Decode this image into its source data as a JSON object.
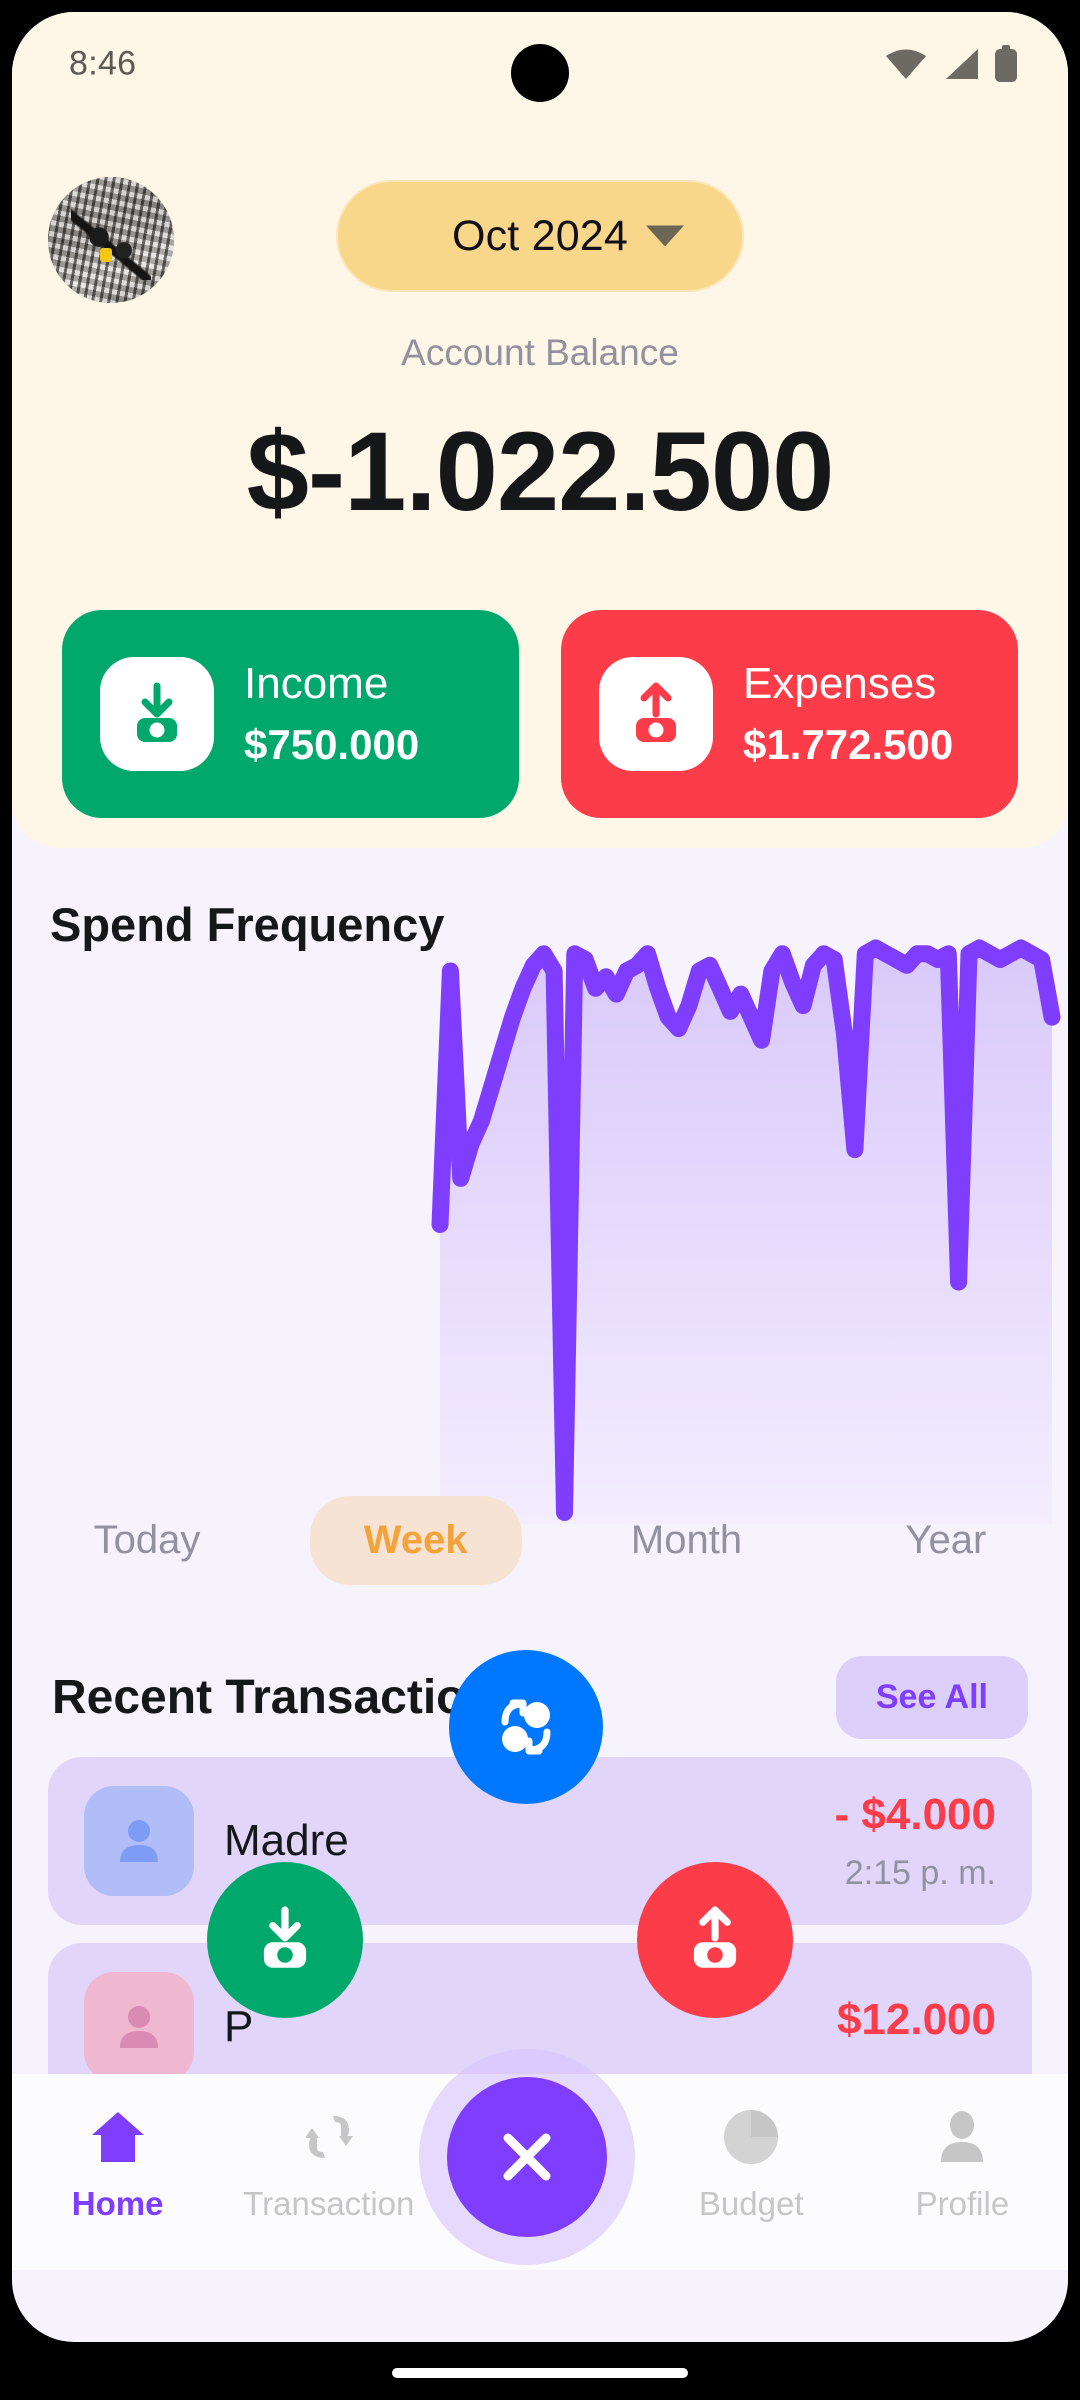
{
  "status_bar": {
    "time": "8:46",
    "icons": [
      "wifi-icon",
      "cellular-icon",
      "battery-icon"
    ]
  },
  "header": {
    "avatar": "user-avatar-motorcycle-photo",
    "month_selector": {
      "value": "Oct 2024",
      "caret": "chevron-down-icon"
    },
    "balance_label": "Account Balance",
    "balance_amount": "$-1.022.500"
  },
  "summary_cards": [
    {
      "type": "income",
      "title": "Income",
      "amount": "$750.000",
      "color": "#00A86B",
      "icon": "income-arrow-down-icon"
    },
    {
      "type": "expense",
      "title": "Expenses",
      "amount": "$1.772.500",
      "color": "#FD3C4A",
      "icon": "expense-arrow-up-icon"
    }
  ],
  "spend_frequency": {
    "title": "Spend Frequency",
    "tabs": [
      {
        "label": "Today",
        "active": false
      },
      {
        "label": "Week",
        "active": true
      },
      {
        "label": "Month",
        "active": false
      },
      {
        "label": "Year",
        "active": false
      }
    ],
    "active_tab_color": "#F2A33C",
    "line_color": "#7F3DFF"
  },
  "chart_data": {
    "type": "area",
    "title": "Spend Frequency",
    "xlabel": "",
    "ylabel": "",
    "ylim": [
      0,
      100
    ],
    "grid": false,
    "legend": null,
    "line_color": "#7F3DFF",
    "fill_color": "#DFD2FA",
    "x": [
      0,
      1,
      2,
      3,
      4,
      5,
      6,
      7,
      8,
      9,
      10,
      11,
      12,
      13,
      14,
      15,
      16,
      17,
      18,
      19,
      20,
      21,
      22,
      23,
      24,
      25,
      26,
      27,
      28,
      29,
      30,
      31,
      32,
      33,
      34,
      35,
      36,
      37,
      38,
      39,
      40,
      41,
      42,
      43,
      44,
      45,
      46,
      47,
      48,
      49,
      50,
      51,
      52,
      53,
      54,
      55,
      56,
      57,
      58,
      59
    ],
    "values": [
      52,
      96,
      60,
      66,
      70,
      76,
      82,
      88,
      93,
      97,
      99,
      96,
      2,
      99,
      98,
      93,
      95,
      92,
      96,
      97,
      99,
      93,
      88,
      86,
      90,
      96,
      97,
      93,
      89,
      92,
      88,
      84,
      96,
      99,
      94,
      90,
      97,
      99,
      98,
      85,
      65,
      99,
      100,
      99,
      98,
      97,
      99,
      99,
      98,
      99,
      42,
      99,
      100,
      99,
      98,
      99,
      100,
      99,
      98,
      88
    ]
  },
  "recent_transactions": {
    "title": "Recent Transactions",
    "see_all_label": "See All",
    "rows": [
      {
        "icon": "person-icon",
        "icon_style": "person",
        "name": "Madre",
        "amount": "- $4.000",
        "time": "2:15 p. m."
      },
      {
        "icon": "person-icon",
        "icon_style": "pink",
        "name": "P",
        "amount": "$12.000",
        "time": ""
      }
    ]
  },
  "fab_menu": {
    "expanded": true,
    "actions": [
      {
        "name": "transfer",
        "icon": "transfer-exchange-icon",
        "color": "#0077FF"
      },
      {
        "name": "income",
        "icon": "income-arrow-down-icon",
        "color": "#00A86B"
      },
      {
        "name": "expense",
        "icon": "expense-arrow-up-icon",
        "color": "#FD3C4A"
      }
    ],
    "main_button": {
      "icon": "close-x-icon",
      "color": "#7F3DFF"
    }
  },
  "bottom_nav": {
    "items": [
      {
        "label": "Home",
        "icon": "home-icon",
        "active": true
      },
      {
        "label": "Transaction",
        "icon": "transaction-icon",
        "active": false
      },
      {
        "label": "Budget",
        "icon": "pie-chart-icon",
        "active": false
      },
      {
        "label": "Profile",
        "icon": "person-icon",
        "active": false
      }
    ],
    "active_color": "#7F3DFF",
    "inactive_color": "#C6C6C6"
  }
}
